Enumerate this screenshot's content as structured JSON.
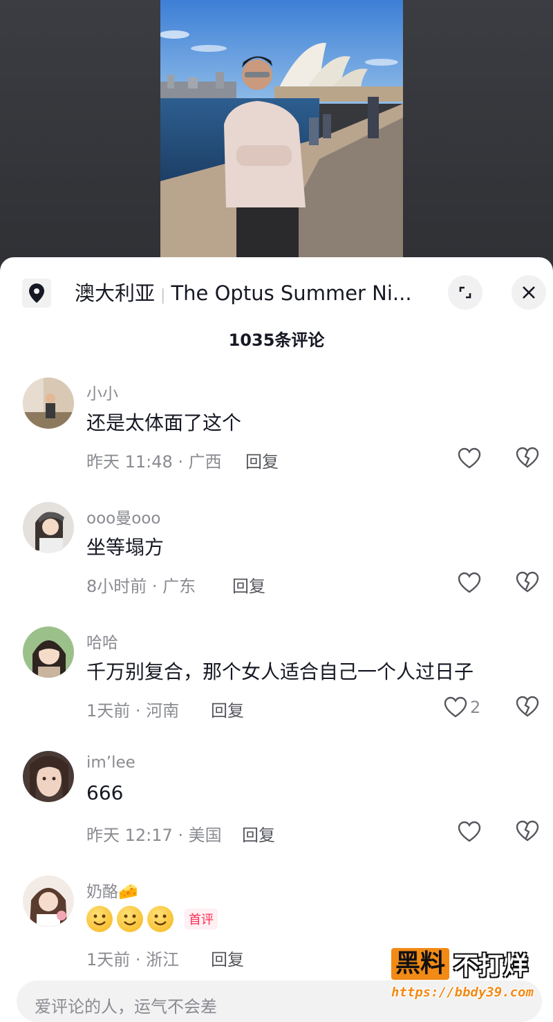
{
  "location": {
    "country": "澳大利亚",
    "venue": "The Optus Summer Ni..."
  },
  "comments_count": "1035条评论",
  "comments": [
    {
      "user": "小小",
      "text": "还是太体面了这个",
      "meta": "昨天 11:48 · 广西",
      "reply": "回复",
      "likes": ""
    },
    {
      "user": "ooo曼ooo",
      "text": "坐等塌方",
      "meta": "8小时前 · 广东",
      "reply": "回复",
      "likes": ""
    },
    {
      "user": "哈哈",
      "text": "千万别复合，那个女人适合自己一个人过日子",
      "meta": "1天前 · 河南",
      "reply": "回复",
      "likes": "2"
    },
    {
      "user": "im’lee",
      "text": "666",
      "meta": "昨天 12:17 · 美国",
      "reply": "回复",
      "likes": ""
    },
    {
      "user": "奶酪🧀",
      "text": "",
      "meta": "1天前 · 浙江",
      "reply": "回复",
      "likes": "",
      "badge": "首评",
      "emoji_count": 3
    }
  ],
  "input": {
    "placeholder": "爱评论的人，运气不会差"
  },
  "watermark": {
    "box_text": "黑料",
    "rest_text": "不打烊",
    "url": "https://bbdy39.com"
  },
  "icons": [
    "location-pin-icon",
    "expand-icon",
    "close-icon",
    "heart-icon",
    "broken-heart-icon",
    "smiley-emoji-icon"
  ]
}
